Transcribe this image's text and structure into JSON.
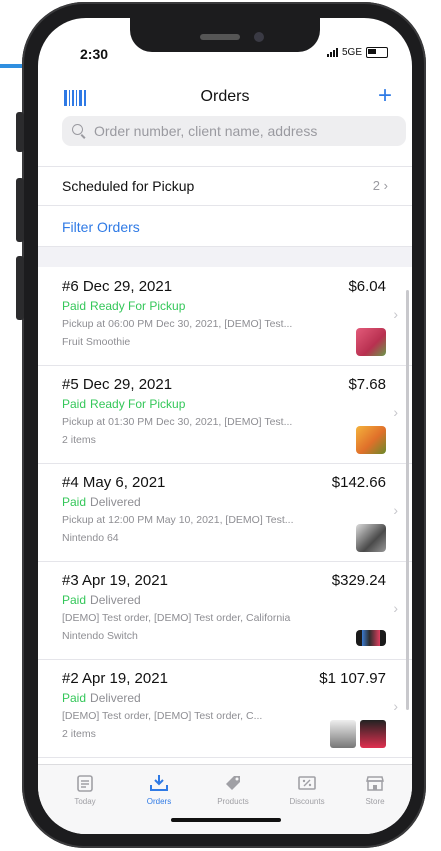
{
  "status": {
    "time": "2:30",
    "network": "5GE"
  },
  "nav": {
    "title": "Orders",
    "add_icon": "plus-icon",
    "scan_icon": "barcode-icon"
  },
  "search": {
    "placeholder": "Order number, client name, address"
  },
  "scheduled": {
    "label": "Scheduled for Pickup",
    "count": "2"
  },
  "filter": {
    "label": "Filter Orders"
  },
  "orders": [
    {
      "title": "#6  Dec 29, 2021",
      "amount": "$6.04",
      "paid": "Paid",
      "status": "Ready For Pickup",
      "detail": "Pickup at 06:00 PM Dec 30, 2021, [DEMO] Test...",
      "item": "Fruit Smoothie"
    },
    {
      "title": "#5  Dec 29, 2021",
      "amount": "$7.68",
      "paid": "Paid",
      "status": "Ready For Pickup",
      "detail": "Pickup at 01:30 PM Dec 30, 2021, [DEMO] Test...",
      "item": "2 items"
    },
    {
      "title": "#4  May 6, 2021",
      "amount": "$142.66",
      "paid": "Paid",
      "status": "Delivered",
      "detail": "Pickup at 12:00 PM May 10, 2021, [DEMO] Test...",
      "item": "Nintendo 64"
    },
    {
      "title": "#3  Apr 19, 2021",
      "amount": "$329.24",
      "paid": "Paid",
      "status": "Delivered",
      "detail": "[DEMO] Test order, [DEMO] Test order, California",
      "item": "Nintendo Switch"
    },
    {
      "title": "#2  Apr 19, 2021",
      "amount": "$1 107.97",
      "paid": "Paid",
      "status": "Delivered",
      "detail": "[DEMO] Test order, [DEMO] Test order, C...",
      "item": "2 items"
    }
  ],
  "tabs": [
    {
      "label": "Today",
      "icon": "calendar-icon"
    },
    {
      "label": "Orders",
      "icon": "download-tray-icon"
    },
    {
      "label": "Products",
      "icon": "tag-icon"
    },
    {
      "label": "Discounts",
      "icon": "discount-icon"
    },
    {
      "label": "Store",
      "icon": "store-icon"
    }
  ],
  "colors": {
    "accent": "#2f7ae5",
    "paid": "#34c759",
    "muted": "#8e8e93"
  }
}
